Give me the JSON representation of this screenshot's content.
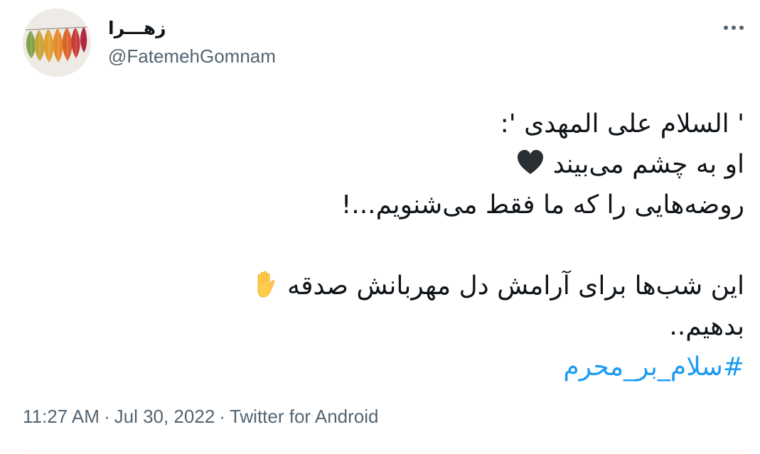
{
  "author": {
    "display_name": "زهـــرا",
    "handle": "@FatemehGomnam"
  },
  "tweet": {
    "line1": "' السلام علی المهدی ':",
    "line2": "او به چشم می‌بیند",
    "line2_icon": "black-heart-icon",
    "line3": "روضه‌هایی را که ما فقط می‌شنویم...!",
    "line4": "این شب‌ها برای آرامش دل مهربانش صدقه",
    "line4_icon": "raised-hand-icon",
    "line5": "بدهیم..",
    "hashtag": "#سلام_بر_محرم"
  },
  "meta": {
    "time": "11:27 AM",
    "separator": "·",
    "date": "Jul 30, 2022",
    "source": "Twitter for Android"
  },
  "colors": {
    "link": "#1d9bf0",
    "secondary_text": "#536471",
    "primary_text": "#0f1419",
    "heart": "#292f33",
    "hand": "#ffcc4d"
  },
  "icons": {
    "more": "more-horizontal-icon",
    "avatar": "autumn-leaves-avatar"
  }
}
